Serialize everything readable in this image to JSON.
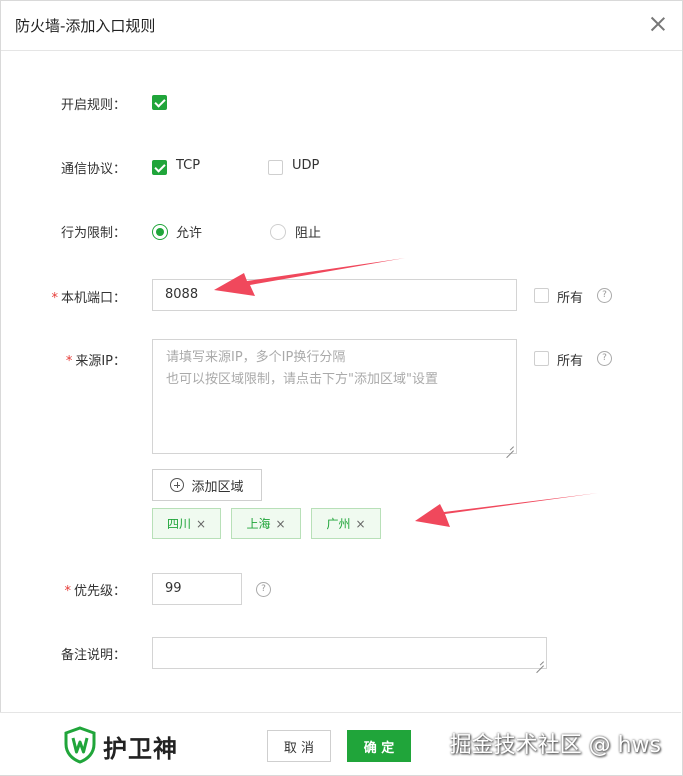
{
  "dialog": {
    "title": "防火墙-添加入口规则"
  },
  "form": {
    "enable_rule": {
      "label": "开启规则：",
      "checked": true
    },
    "protocol": {
      "label": "通信协议：",
      "options": [
        {
          "label": "TCP",
          "checked": true
        },
        {
          "label": "UDP",
          "checked": false
        }
      ]
    },
    "action": {
      "label": "行为限制：",
      "options": [
        {
          "label": "允许",
          "selected": true
        },
        {
          "label": "阻止",
          "selected": false
        }
      ]
    },
    "port": {
      "required_mark": "*",
      "label": "本机端口：",
      "value": "8088",
      "all_label": "所有",
      "all_checked": false
    },
    "source_ip": {
      "required_mark": "*",
      "label": "来源IP：",
      "placeholder_line1": "请填写来源IP，多个IP换行分隔",
      "placeholder_line2": "也可以按区域限制，请点击下方\"添加区域\"设置",
      "all_label": "所有",
      "all_checked": false
    },
    "add_region_label": "添加区域",
    "regions": [
      "四川",
      "上海",
      "广州"
    ],
    "priority": {
      "required_mark": "*",
      "label": "优先级：",
      "value": "99"
    },
    "remark": {
      "label": "备注说明：",
      "value": ""
    }
  },
  "footer": {
    "logo_text": "护卫神",
    "cancel_label": "取 消",
    "confirm_label": "确 定",
    "watermark": "掘金技术社区 @ hws"
  },
  "icons": {
    "help": "?",
    "tag_remove": "×"
  },
  "colors": {
    "accent": "#20a53a",
    "required": "#e53935",
    "arrow": "#f0485c"
  }
}
